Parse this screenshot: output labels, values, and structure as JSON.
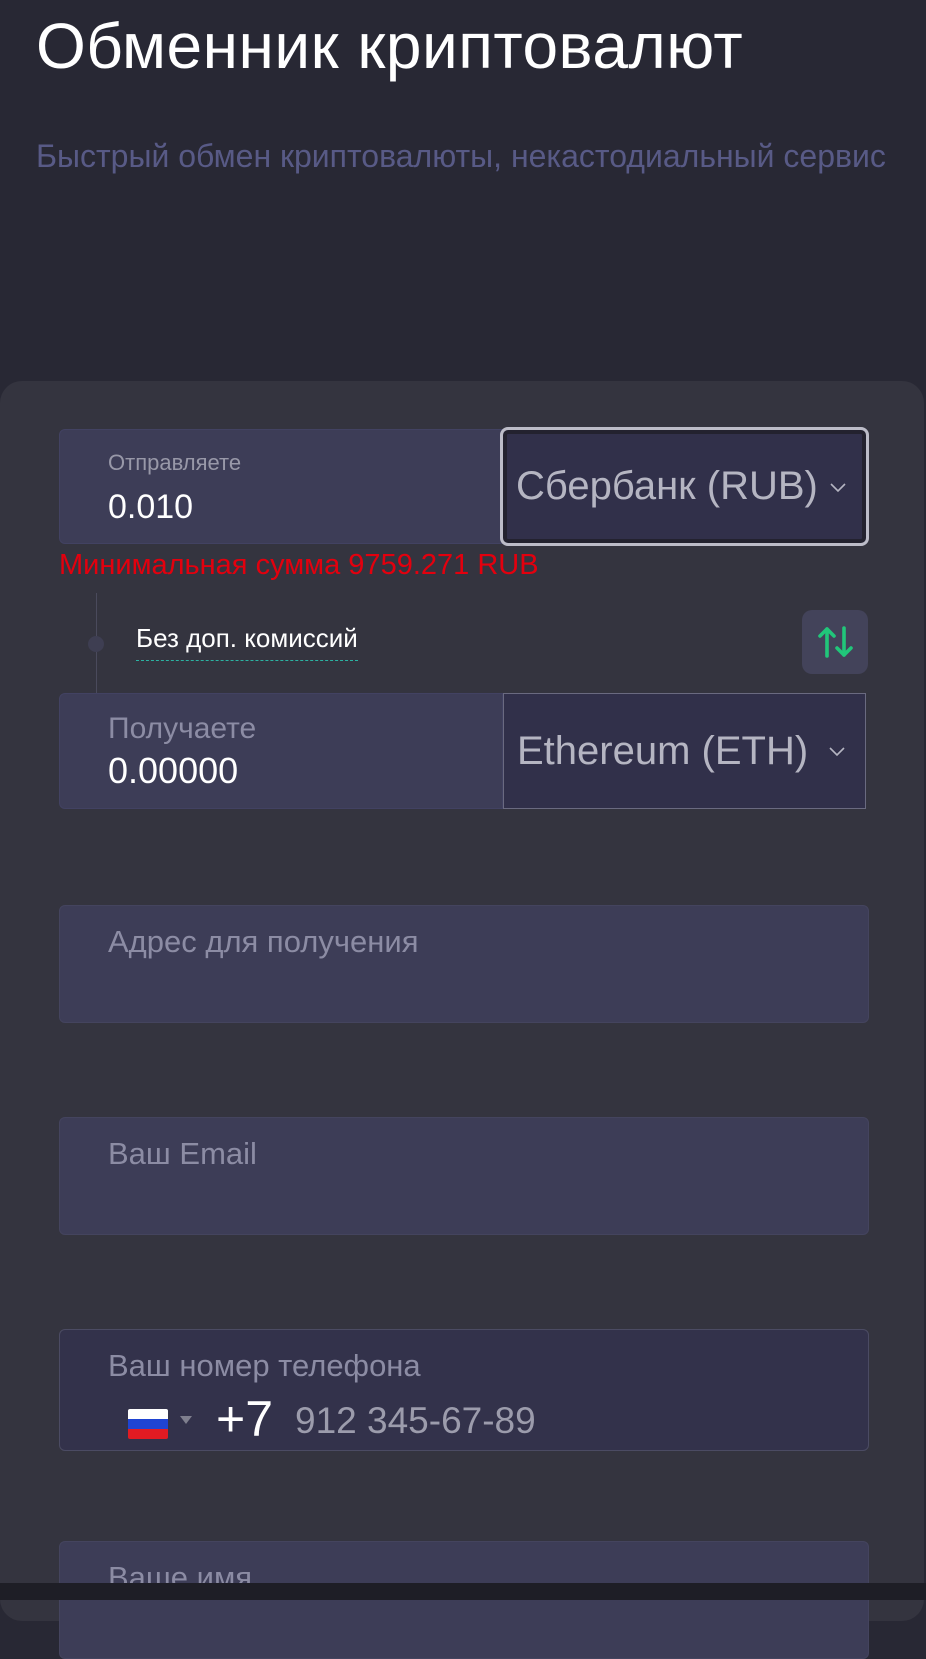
{
  "header": {
    "title": "Обменник криптовалют",
    "subtitle": "Быстрый обмен криптовалюты, некастодиальный сервис"
  },
  "exchange": {
    "send": {
      "label": "Отправляете",
      "amount": "0.010",
      "currency": "Сбербанк (RUB)"
    },
    "error": "Минимальная сумма 9759.271 RUB",
    "fee_note": "Без доп. комиссий",
    "receive": {
      "label": "Получаете",
      "amount": "0.00000",
      "currency": "Ethereum (ETH)"
    }
  },
  "form": {
    "address_placeholder": "Адрес для получения",
    "email_placeholder": "Ваш Email",
    "phone": {
      "label": "Ваш номер телефона",
      "country_icon": "russia-flag-icon",
      "dial_code": "+7",
      "placeholder": "912 345-67-89"
    },
    "name_placeholder": "Ваше имя"
  },
  "colors": {
    "background": "#282834",
    "card": "#34343f",
    "field": "#3d3d57",
    "error": "#e3000e",
    "swap_arrows": "#21c67a",
    "subtitle": "#585a86"
  }
}
